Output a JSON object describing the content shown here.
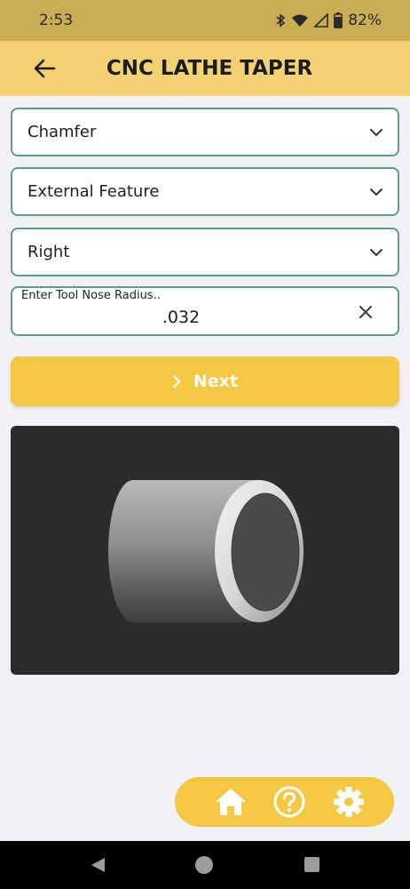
{
  "status": {
    "time": "2:53",
    "battery": "82%"
  },
  "app_bar": {
    "title": "CNC LATHE TAPER"
  },
  "form": {
    "operation_select": "Chamfer",
    "feature_select": "External Feature",
    "direction_select": "Right",
    "tool_nose": {
      "label": "Enter Tool Nose Radius..",
      "value": ".032"
    },
    "next_label": "Next"
  },
  "colors": {
    "accent_yellow": "#f5c843",
    "app_bar": "#f4d274",
    "status_bar": "#cbad56",
    "field_border": "#5b9e85",
    "image_bg": "#2b2b2b"
  },
  "icons": {
    "back": "arrow-left-icon",
    "dropdown": "chevron-down-icon",
    "clear": "close-icon",
    "next": "chevron-right-icon",
    "home": "home-icon",
    "help": "help-circle-icon",
    "settings": "gear-icon"
  }
}
